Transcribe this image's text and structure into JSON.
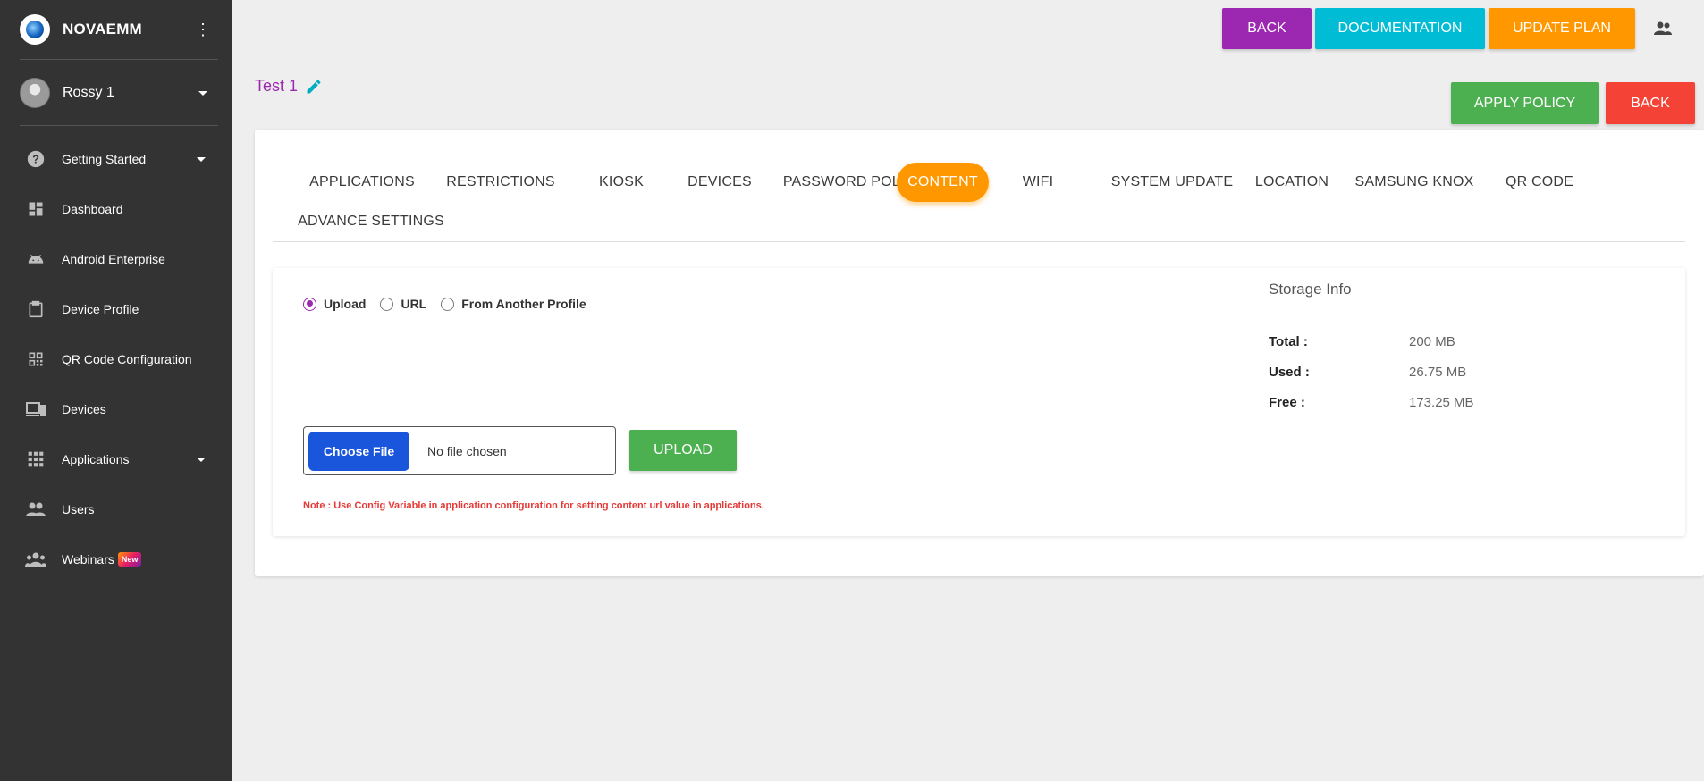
{
  "brand": {
    "name": "NOVAEMM"
  },
  "user": {
    "name": "Rossy 1"
  },
  "sidebar": {
    "items": [
      {
        "label": "Getting Started",
        "icon": "help-circle-icon",
        "has_caret": true
      },
      {
        "label": "Dashboard",
        "icon": "dashboard-icon"
      },
      {
        "label": "Android Enterprise",
        "icon": "android-icon"
      },
      {
        "label": "Device Profile",
        "icon": "clipboard-icon"
      },
      {
        "label": "QR Code Configuration",
        "icon": "qr-code-icon"
      },
      {
        "label": "Devices",
        "icon": "devices-icon"
      },
      {
        "label": "Applications",
        "icon": "apps-grid-icon",
        "has_caret": true
      },
      {
        "label": "Users",
        "icon": "users-icon"
      },
      {
        "label": "Webinars",
        "icon": "group-icon",
        "badge": "New"
      }
    ]
  },
  "header": {
    "back_label": "BACK",
    "documentation_label": "DOCUMENTATION",
    "update_plan_label": "UPDATE PLAN"
  },
  "profile": {
    "title": "Test 1",
    "apply_policy_label": "APPLY POLICY",
    "back_label": "BACK"
  },
  "tabs": [
    {
      "label": "APPLICATIONS"
    },
    {
      "label": "RESTRICTIONS"
    },
    {
      "label": "KIOSK"
    },
    {
      "label": "DEVICES"
    },
    {
      "label": "PASSWORD POLICY"
    },
    {
      "label": "CONTENT",
      "active": true
    },
    {
      "label": "WIFI"
    },
    {
      "label": "SYSTEM UPDATE"
    },
    {
      "label": "LOCATION"
    },
    {
      "label": "SAMSUNG KNOX"
    },
    {
      "label": "QR CODE"
    },
    {
      "label": "ADVANCE SETTINGS"
    }
  ],
  "content": {
    "source_options": [
      {
        "label": "Upload",
        "checked": true
      },
      {
        "label": "URL",
        "checked": false
      },
      {
        "label": "From Another Profile",
        "checked": false
      }
    ],
    "choose_file_label": "Choose File",
    "file_status": "No file chosen",
    "upload_label": "UPLOAD",
    "note": "Note : Use Config Variable in application configuration for setting content url value in applications."
  },
  "storage": {
    "title": "Storage Info",
    "rows": [
      {
        "label": "Total :",
        "value": "200 MB"
      },
      {
        "label": "Used :",
        "value": "26.75 MB"
      },
      {
        "label": "Free :",
        "value": "173.25 MB"
      }
    ]
  },
  "colors": {
    "sidebar_bg": "#333333",
    "back_purple": "#9c27b0",
    "documentation_cyan": "#00bcd4",
    "update_plan_orange": "#ff9800",
    "apply_green": "#4caf50",
    "back_red": "#f44336",
    "active_tab_orange": "#ff9800",
    "choose_file_blue": "#1a56db",
    "note_red": "#e53935"
  }
}
